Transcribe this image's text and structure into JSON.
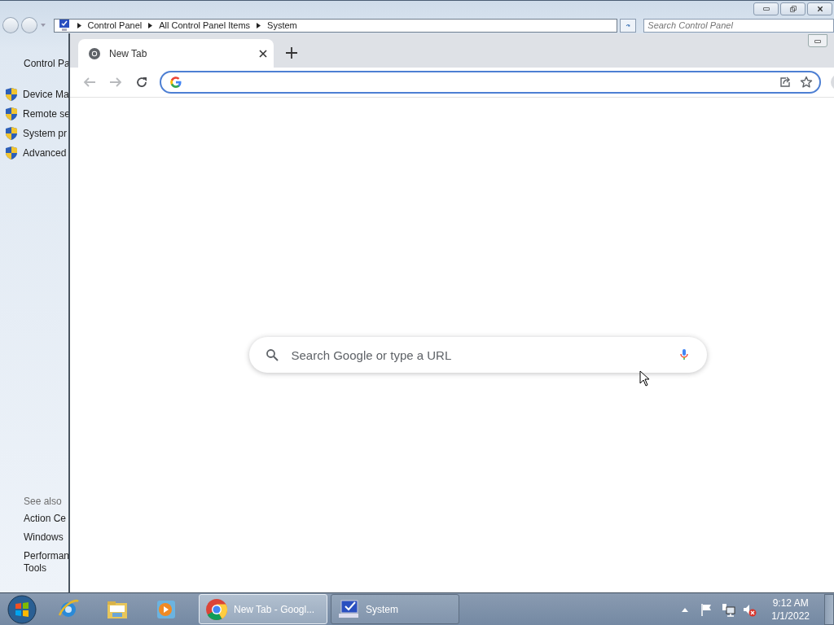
{
  "control_panel": {
    "breadcrumb": [
      "Control Panel",
      "All Control Panel Items",
      "System"
    ],
    "search": {
      "placeholder": "Search Control Panel"
    },
    "sidebar": {
      "home": "Control Pa",
      "tasks": [
        "Device Ma",
        "Remote se",
        "System pr",
        "Advanced"
      ],
      "see_also_heading": "See also",
      "see_also": [
        {
          "lines": [
            "Action Ce"
          ]
        },
        {
          "lines": [
            "Windows"
          ]
        },
        {
          "lines": [
            "Performan",
            "Tools"
          ]
        }
      ]
    }
  },
  "browser": {
    "tabs": [
      {
        "label": "New Tab",
        "selected": true
      }
    ],
    "nav": [
      {
        "kind": "back",
        "disabled": true
      },
      {
        "kind": "forward",
        "disabled": true
      },
      {
        "kind": "reload",
        "disabled": false
      }
    ],
    "omnibox": {
      "focused": true
    },
    "search": {
      "placeholder": "Search Google or type a URL"
    }
  },
  "taskbar": {
    "pinned": [
      {
        "kind": "ie"
      },
      {
        "kind": "explorer"
      },
      {
        "kind": "media"
      }
    ],
    "tasks": [
      {
        "kind": "chrome",
        "label": "New Tab - Googl...",
        "selected": true
      },
      {
        "kind": "system",
        "label": "System",
        "selected": false
      }
    ],
    "tray": [
      {
        "kind": "flag"
      },
      {
        "kind": "network"
      },
      {
        "kind": "volume-muted"
      }
    ],
    "clock": {
      "time": "9:12 AM",
      "date": "1/1/2022"
    }
  }
}
